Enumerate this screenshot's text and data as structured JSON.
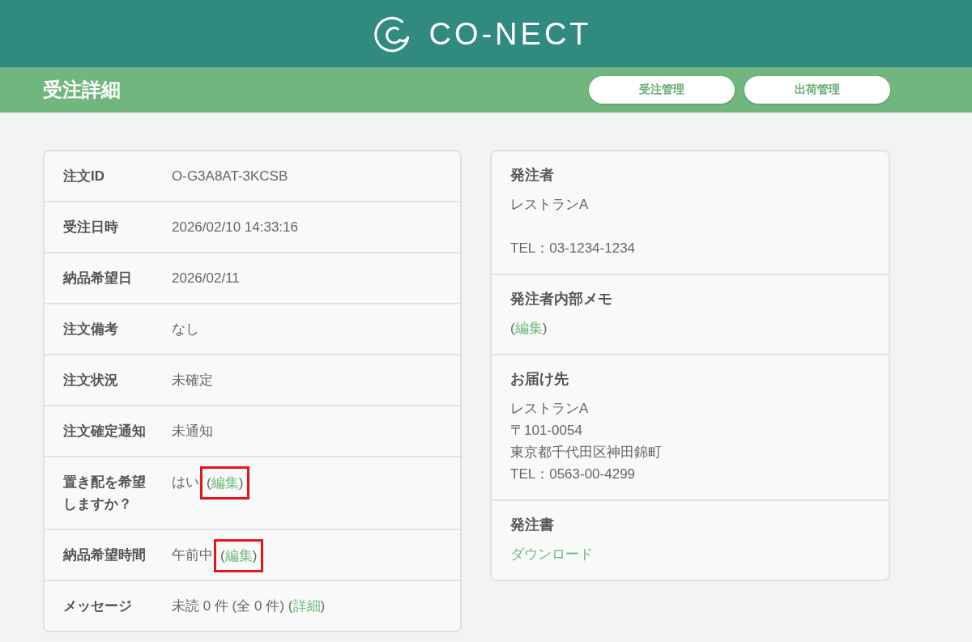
{
  "header": {
    "logo_text": "CO-NECT"
  },
  "page_bar": {
    "title": "受注詳細",
    "buttons": [
      {
        "label": "受注管理"
      },
      {
        "label": "出荷管理"
      }
    ]
  },
  "order_details": {
    "rows": [
      {
        "label": "注文ID",
        "value": [
          {
            "kind": "text",
            "text": "O-G3A8AT-3KCSB"
          }
        ]
      },
      {
        "label": "受注日時",
        "value": [
          {
            "kind": "text",
            "text": "2026/02/10 14:33:16"
          }
        ]
      },
      {
        "label": "納品希望日",
        "value": [
          {
            "kind": "text",
            "text": "2026/02/11"
          }
        ]
      },
      {
        "label": "注文備考",
        "value": [
          {
            "kind": "text",
            "text": "なし"
          }
        ]
      },
      {
        "label": "注文状況",
        "value": [
          {
            "kind": "text",
            "text": "未確定"
          }
        ]
      },
      {
        "label": "注文確定通知",
        "value": [
          {
            "kind": "text",
            "text": "未通知"
          }
        ]
      },
      {
        "label": "置き配を希望しますか？",
        "value": [
          {
            "kind": "text",
            "text": "はい"
          },
          {
            "kind": "link",
            "before": "(",
            "text": "編集",
            "after": ")",
            "highlighted": true
          }
        ]
      },
      {
        "label": "納品希望時間",
        "value": [
          {
            "kind": "text",
            "text": "午前中"
          },
          {
            "kind": "link",
            "before": "(",
            "text": "編集",
            "after": ")",
            "highlighted": true
          }
        ]
      },
      {
        "label": "メッセージ",
        "value": [
          {
            "kind": "text",
            "text": "未読 0 件 (全 0 件)"
          },
          {
            "kind": "link",
            "before": "(",
            "text": "詳細",
            "after": ")",
            "highlighted": false
          }
        ]
      }
    ]
  },
  "customer_panel": {
    "sections": [
      {
        "title": "発注者",
        "paragraphs": [
          [
            {
              "kind": "text",
              "text": "レストランA"
            }
          ],
          [
            {
              "kind": "text",
              "text": "TEL：03-1234-1234"
            }
          ]
        ]
      },
      {
        "title": "発注者内部メモ",
        "paragraphs": [
          [
            {
              "kind": "link",
              "before": "(",
              "text": "編集",
              "after": ")",
              "highlighted": false
            }
          ]
        ]
      },
      {
        "title": "お届け先",
        "paragraphs": [
          [
            {
              "kind": "text",
              "text": "レストランA"
            },
            {
              "kind": "text",
              "text": "〒101-0054"
            },
            {
              "kind": "text",
              "text": "東京都千代田区神田錦町"
            },
            {
              "kind": "text",
              "text": "TEL：0563-00-4299"
            }
          ]
        ]
      },
      {
        "title": "発注書",
        "paragraphs": [
          [
            {
              "kind": "link",
              "text": "ダウンロード",
              "highlighted": false
            }
          ]
        ]
      }
    ]
  }
}
